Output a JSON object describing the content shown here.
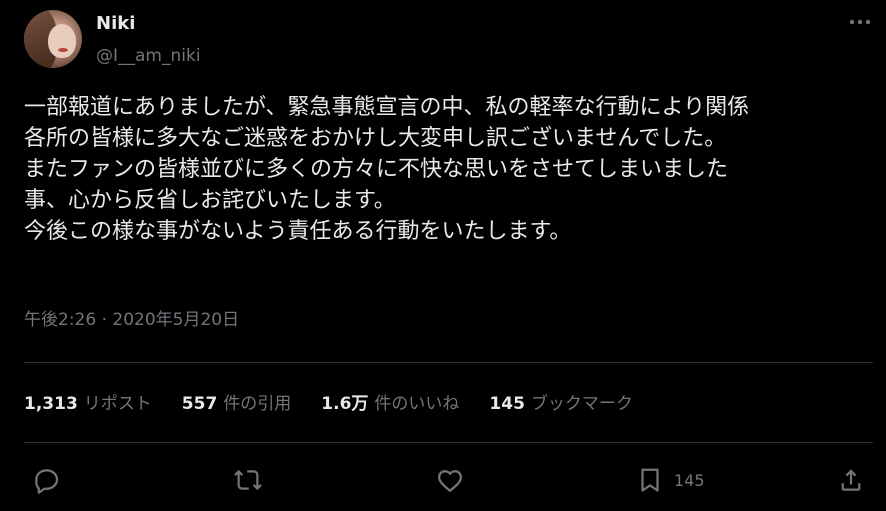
{
  "user": {
    "display_name": "Niki",
    "handle": "@I__am_niki"
  },
  "tweet": {
    "lines": [
      "一部報道にありましたが、緊急事態宣言の中、私の軽率な行動により関係",
      "各所の皆様に多大なご迷惑をおかけし大変申し訳ございませんでした。",
      "またファンの皆様並びに多くの方々に不快な思いをさせてしまいました",
      "事、心から反省しお詫びいたします。",
      "今後この様な事がないよう責任ある行動をいたします。"
    ],
    "timestamp": "午後2:26 · 2020年5月20日"
  },
  "stats": {
    "reposts": {
      "count": "1,313",
      "label": "リポスト"
    },
    "quotes": {
      "count": "557",
      "label": "件の引用"
    },
    "likes": {
      "count": "1.6万",
      "label": "件のいいね"
    },
    "bookmarks": {
      "count": "145",
      "label": "ブックマーク"
    }
  },
  "actions": {
    "bookmark_count": "145"
  },
  "icons": {
    "more": "more-horizontal-icon",
    "reply": "reply-icon",
    "repost": "repost-icon",
    "like": "heart-icon",
    "bookmark": "bookmark-icon",
    "share": "share-icon"
  },
  "colors": {
    "background": "#000000",
    "text_primary": "#e7e9ea",
    "text_secondary": "#71767b",
    "divider": "#2f3336"
  }
}
